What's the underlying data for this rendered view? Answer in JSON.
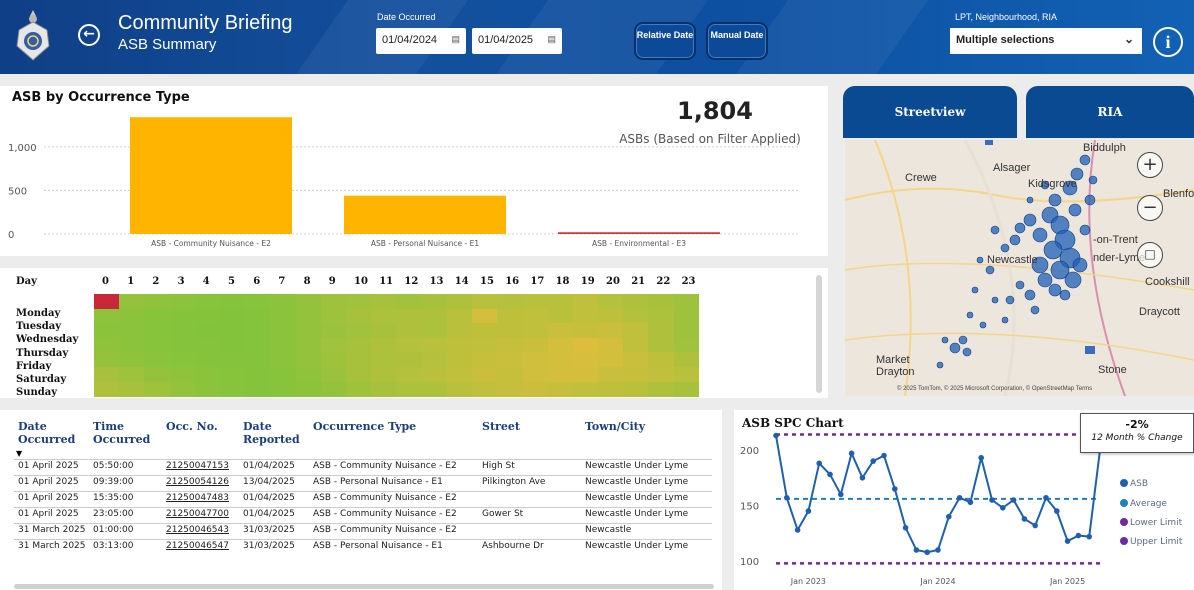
{
  "header": {
    "title": "Community Briefing",
    "subtitle": "ASB Summary",
    "date_label": "Date Occurred",
    "date_from": "01/04/2024",
    "date_to": "01/04/2025",
    "relative_button": "Relative Date",
    "manual_button": "Manual Date",
    "filter_label": "LPT, Neighbourhood, RIA",
    "filter_value": "Multiple selections",
    "info_icon": "info-icon",
    "back_icon": "back-arrow-icon"
  },
  "bar_panel": {
    "title": "ASB by Occurrence Type",
    "kpi_value": "1,804",
    "kpi_label": "ASBs (Based on Filter Applied)"
  },
  "chart_data": [
    {
      "type": "bar",
      "title": "ASB by Occurrence Type",
      "categories": [
        "ASB - Community Nuisance - E2",
        "ASB - Personal Nuisance - E1",
        "ASB - Environmental - E3"
      ],
      "values": [
        1340,
        440,
        20
      ],
      "ytick_labels": [
        "0",
        "500",
        "1,000"
      ],
      "yticks": [
        0,
        500,
        1000
      ],
      "ylim": [
        0,
        1400
      ],
      "colors": [
        "#ffb400",
        "#ffb400",
        "#d9342b"
      ],
      "grid": true
    },
    {
      "type": "heatmap",
      "row_header": "Day",
      "rows": [
        "Monday",
        "Tuesday",
        "Wednesday",
        "Thursday",
        "Friday",
        "Saturday",
        "Sunday"
      ],
      "columns": [
        "0",
        "1",
        "2",
        "3",
        "4",
        "5",
        "6",
        "7",
        "8",
        "9",
        "10",
        "11",
        "12",
        "13",
        "14",
        "15",
        "16",
        "17",
        "18",
        "19",
        "20",
        "21",
        "22",
        "23"
      ],
      "note": "values 0-1 relative intensity",
      "values": [
        [
          1.0,
          0.15,
          0.12,
          0.1,
          0.08,
          0.07,
          0.08,
          0.1,
          0.15,
          0.2,
          0.22,
          0.25,
          0.22,
          0.25,
          0.3,
          0.35,
          0.33,
          0.35,
          0.35,
          0.4,
          0.32,
          0.3,
          0.25,
          0.2
        ],
        [
          0.12,
          0.1,
          0.08,
          0.07,
          0.06,
          0.05,
          0.07,
          0.1,
          0.15,
          0.2,
          0.25,
          0.28,
          0.3,
          0.3,
          0.35,
          0.5,
          0.38,
          0.4,
          0.35,
          0.4,
          0.38,
          0.32,
          0.28,
          0.2
        ],
        [
          0.1,
          0.1,
          0.08,
          0.06,
          0.05,
          0.05,
          0.06,
          0.1,
          0.15,
          0.18,
          0.22,
          0.25,
          0.3,
          0.28,
          0.35,
          0.38,
          0.38,
          0.4,
          0.45,
          0.42,
          0.45,
          0.4,
          0.3,
          0.2
        ],
        [
          0.12,
          0.1,
          0.08,
          0.07,
          0.06,
          0.05,
          0.07,
          0.1,
          0.15,
          0.22,
          0.25,
          0.3,
          0.32,
          0.35,
          0.38,
          0.4,
          0.42,
          0.45,
          0.5,
          0.55,
          0.5,
          0.4,
          0.3,
          0.22
        ],
        [
          0.15,
          0.12,
          0.1,
          0.08,
          0.07,
          0.06,
          0.07,
          0.1,
          0.15,
          0.2,
          0.25,
          0.28,
          0.3,
          0.32,
          0.38,
          0.42,
          0.45,
          0.48,
          0.5,
          0.52,
          0.5,
          0.45,
          0.38,
          0.3
        ],
        [
          0.25,
          0.2,
          0.15,
          0.12,
          0.1,
          0.08,
          0.07,
          0.08,
          0.12,
          0.18,
          0.25,
          0.3,
          0.32,
          0.35,
          0.4,
          0.45,
          0.42,
          0.48,
          0.5,
          0.5,
          0.45,
          0.42,
          0.4,
          0.35
        ],
        [
          0.3,
          0.25,
          0.2,
          0.15,
          0.1,
          0.08,
          0.07,
          0.08,
          0.1,
          0.15,
          0.2,
          0.25,
          0.28,
          0.3,
          0.35,
          0.4,
          0.42,
          0.45,
          0.42,
          0.4,
          0.38,
          0.35,
          0.3,
          0.25
        ]
      ]
    },
    {
      "type": "line",
      "title": "ASB SPC Chart",
      "x_tick_labels": [
        "Jan 2023",
        "Jan 2024",
        "Jan 2025"
      ],
      "y_tick_labels": [
        "100",
        "150",
        "200"
      ],
      "ylim": [
        92,
        218
      ],
      "series": [
        {
          "name": "ASB",
          "color": "#1f5fb0",
          "values": [
            213,
            157,
            128,
            145,
            188,
            178,
            160,
            197,
            175,
            190,
            195,
            165,
            130,
            110,
            108,
            110,
            140,
            157,
            153,
            193,
            155,
            148,
            155,
            138,
            132,
            157,
            145,
            118,
            123,
            122,
            200
          ]
        },
        {
          "name": "Average",
          "color": "#1f7fc0",
          "value": 156
        },
        {
          "name": "Lower Limit",
          "color": "#6a2ca0",
          "value": 98
        },
        {
          "name": "Upper Limit",
          "color": "#6a2ca0",
          "value": 214
        }
      ]
    }
  ],
  "heatmap_panel": {
    "row_header": "Day",
    "days": [
      "Monday",
      "Tuesday",
      "Wednesday",
      "Thursday",
      "Friday",
      "Saturday",
      "Sunday"
    ],
    "hours": [
      "0",
      "1",
      "2",
      "3",
      "4",
      "5",
      "6",
      "7",
      "8",
      "9",
      "10",
      "11",
      "12",
      "13",
      "14",
      "15",
      "16",
      "17",
      "18",
      "19",
      "20",
      "21",
      "22",
      "23"
    ]
  },
  "map_panel": {
    "streetview_button": "Streetview",
    "ria_button": "RIA",
    "labels": [
      "Alsager",
      "Biddulph",
      "Crewe",
      "Kidsgrove",
      "Newcastle",
      "-on-Trent",
      "nder-Lyme",
      "Cookshill",
      "Draycott",
      "Market Drayton",
      "Stone",
      "Blenford"
    ],
    "attribution": "© 2025 TomTom, © 2025 Microsoft Corporation, © OpenStreetMap  Terms"
  },
  "table": {
    "headers": [
      "Date Occurred",
      "Time Occurred",
      "Occ. No.",
      "Date Reported",
      "Occurrence Type",
      "Street",
      "Town/City"
    ],
    "rows": [
      [
        "01 April 2025",
        "05:50:00",
        "21250047153",
        "01/04/2025",
        "ASB - Community Nuisance - E2",
        "High St",
        "Newcastle Under Lyme"
      ],
      [
        "01 April 2025",
        "09:39:00",
        "21250054126",
        "13/04/2025",
        "ASB - Personal Nuisance - E1",
        "Pilkington Ave",
        "Newcastle Under Lyme"
      ],
      [
        "01 April 2025",
        "15:35:00",
        "21250047483",
        "01/04/2025",
        "ASB - Community Nuisance - E2",
        "",
        "Newcastle Under Lyme"
      ],
      [
        "01 April 2025",
        "23:05:00",
        "21250047700",
        "01/04/2025",
        "ASB - Community Nuisance - E2",
        "Gower St",
        "Newcastle Under Lyme"
      ],
      [
        "31 March 2025",
        "01:00:00",
        "21250046543",
        "31/03/2025",
        "ASB - Community Nuisance - E2",
        "",
        "Newcastle"
      ],
      [
        "31 March 2025",
        "03:13:00",
        "21250046547",
        "31/03/2025",
        "ASB - Personal Nuisance - E1",
        "Ashbourne Dr",
        "Newcastle Under Lyme"
      ]
    ]
  },
  "spc_panel": {
    "title": "ASB SPC Chart",
    "kpi_value": "-2%",
    "kpi_label": "12 Month % Change",
    "legend": [
      "ASB",
      "Average",
      "Lower Limit",
      "Upper Limit"
    ]
  },
  "colors": {
    "header_blue": "#13509e",
    "bar_yellow": "#ffb400",
    "bar_red": "#d9342b",
    "spc_line": "#1f5fb0",
    "limit_purple": "#6a2ca0"
  }
}
